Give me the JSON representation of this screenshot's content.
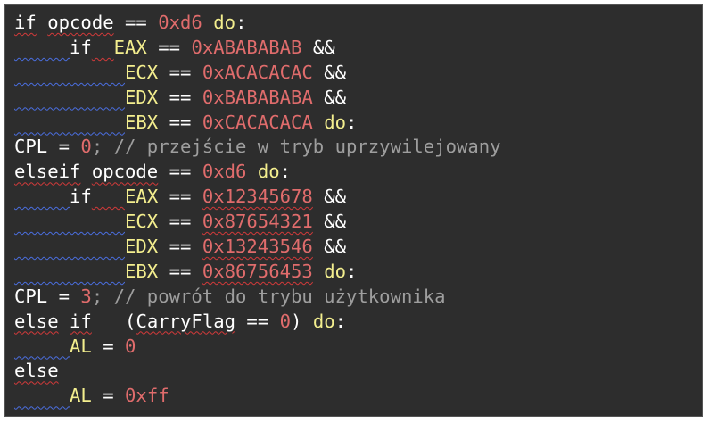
{
  "code_lines": [
    [
      {
        "t": "if",
        "c": "plain",
        "sq": "red"
      },
      {
        "t": " ",
        "c": "plain"
      },
      {
        "t": "opcode",
        "c": "plain",
        "sq": "red"
      },
      {
        "t": " == ",
        "c": "plain"
      },
      {
        "t": "0xd6",
        "c": "num"
      },
      {
        "t": " ",
        "c": "plain"
      },
      {
        "t": "do",
        "c": "kw"
      },
      {
        "t": ":",
        "c": "plain"
      }
    ],
    [
      {
        "t": "     ",
        "c": "plain",
        "sq": "blue"
      },
      {
        "t": "if",
        "c": "plain"
      },
      {
        "t": "  ",
        "c": "plain",
        "sq": "red"
      },
      {
        "t": "EAX",
        "c": "reg"
      },
      {
        "t": " == ",
        "c": "plain"
      },
      {
        "t": "0xABABABAB",
        "c": "num"
      },
      {
        "t": " &&",
        "c": "plain"
      }
    ],
    [
      {
        "t": "          ",
        "c": "plain",
        "sq": "blue"
      },
      {
        "t": "ECX",
        "c": "reg"
      },
      {
        "t": " == ",
        "c": "plain"
      },
      {
        "t": "0xACACACAC",
        "c": "num"
      },
      {
        "t": " &&",
        "c": "plain"
      }
    ],
    [
      {
        "t": "          ",
        "c": "plain",
        "sq": "blue"
      },
      {
        "t": "EDX",
        "c": "reg"
      },
      {
        "t": " == ",
        "c": "plain"
      },
      {
        "t": "0xBABABABA",
        "c": "num"
      },
      {
        "t": " &&",
        "c": "plain"
      }
    ],
    [
      {
        "t": "          ",
        "c": "plain",
        "sq": "blue"
      },
      {
        "t": "EBX",
        "c": "reg"
      },
      {
        "t": " == ",
        "c": "plain"
      },
      {
        "t": "0xCACACACA",
        "c": "num"
      },
      {
        "t": " ",
        "c": "plain"
      },
      {
        "t": "do",
        "c": "kw"
      },
      {
        "t": ":",
        "c": "plain"
      }
    ],
    [
      {
        "t": "CPL",
        "c": "plain"
      },
      {
        "t": " = ",
        "c": "plain"
      },
      {
        "t": "0",
        "c": "num"
      },
      {
        "t": "; // przejście w tryb uprzywilejowany",
        "c": "comment"
      }
    ],
    [
      {
        "t": "elseif",
        "c": "plain",
        "sq": "red"
      },
      {
        "t": " ",
        "c": "plain"
      },
      {
        "t": "opcode",
        "c": "plain",
        "sq": "red"
      },
      {
        "t": " == ",
        "c": "plain"
      },
      {
        "t": "0xd6",
        "c": "num"
      },
      {
        "t": " ",
        "c": "plain"
      },
      {
        "t": "do",
        "c": "kw"
      },
      {
        "t": ":",
        "c": "plain"
      }
    ],
    [
      {
        "t": "     ",
        "c": "plain",
        "sq": "blue"
      },
      {
        "t": "if",
        "c": "plain"
      },
      {
        "t": "   ",
        "c": "plain",
        "sq": "red"
      },
      {
        "t": "EAX",
        "c": "reg"
      },
      {
        "t": " == ",
        "c": "plain"
      },
      {
        "t": "0x12345678",
        "c": "num",
        "sq": "red"
      },
      {
        "t": " &&",
        "c": "plain"
      }
    ],
    [
      {
        "t": "          ",
        "c": "plain",
        "sq": "blue"
      },
      {
        "t": "ECX",
        "c": "reg"
      },
      {
        "t": " == ",
        "c": "plain"
      },
      {
        "t": "0x87654321",
        "c": "num",
        "sq": "red"
      },
      {
        "t": " &&",
        "c": "plain"
      }
    ],
    [
      {
        "t": "          ",
        "c": "plain",
        "sq": "blue"
      },
      {
        "t": "EDX",
        "c": "reg"
      },
      {
        "t": " == ",
        "c": "plain"
      },
      {
        "t": "0x13243546",
        "c": "num",
        "sq": "red"
      },
      {
        "t": " &&",
        "c": "plain"
      }
    ],
    [
      {
        "t": "          ",
        "c": "plain",
        "sq": "blue"
      },
      {
        "t": "EBX",
        "c": "reg"
      },
      {
        "t": " == ",
        "c": "plain"
      },
      {
        "t": "0x86756453",
        "c": "num",
        "sq": "red"
      },
      {
        "t": " ",
        "c": "plain"
      },
      {
        "t": "do",
        "c": "kw"
      },
      {
        "t": ":",
        "c": "plain"
      }
    ],
    [
      {
        "t": "CPL",
        "c": "plain"
      },
      {
        "t": " = ",
        "c": "plain"
      },
      {
        "t": "3",
        "c": "num"
      },
      {
        "t": "; // powrót do trybu użytkownika",
        "c": "comment"
      }
    ],
    [
      {
        "t": "else",
        "c": "plain",
        "sq": "red"
      },
      {
        "t": " ",
        "c": "plain"
      },
      {
        "t": "if",
        "c": "plain",
        "sq": "red"
      },
      {
        "t": "   (",
        "c": "plain"
      },
      {
        "t": "CarryFlag",
        "c": "plain",
        "sq": "red"
      },
      {
        "t": " == ",
        "c": "plain"
      },
      {
        "t": "0",
        "c": "num"
      },
      {
        "t": ") ",
        "c": "plain"
      },
      {
        "t": "do",
        "c": "kw"
      },
      {
        "t": ":",
        "c": "plain"
      }
    ],
    [
      {
        "t": "     ",
        "c": "plain",
        "sq": "blue"
      },
      {
        "t": "AL",
        "c": "reg"
      },
      {
        "t": " = ",
        "c": "plain"
      },
      {
        "t": "0",
        "c": "num"
      }
    ],
    [
      {
        "t": "else",
        "c": "plain",
        "sq": "red"
      }
    ],
    [
      {
        "t": "     ",
        "c": "plain",
        "sq": "blue"
      },
      {
        "t": "AL",
        "c": "reg"
      },
      {
        "t": " = ",
        "c": "plain"
      },
      {
        "t": "0xff",
        "c": "num"
      }
    ]
  ],
  "colors": {
    "background": "#2d2d2d",
    "text": "#ffffff",
    "number": "#e06c6c",
    "register": "#f3ee8e",
    "comment": "#9e9e9e",
    "spellcheck_red": "#d23a3a",
    "spellcheck_blue": "#4a6ee0"
  }
}
